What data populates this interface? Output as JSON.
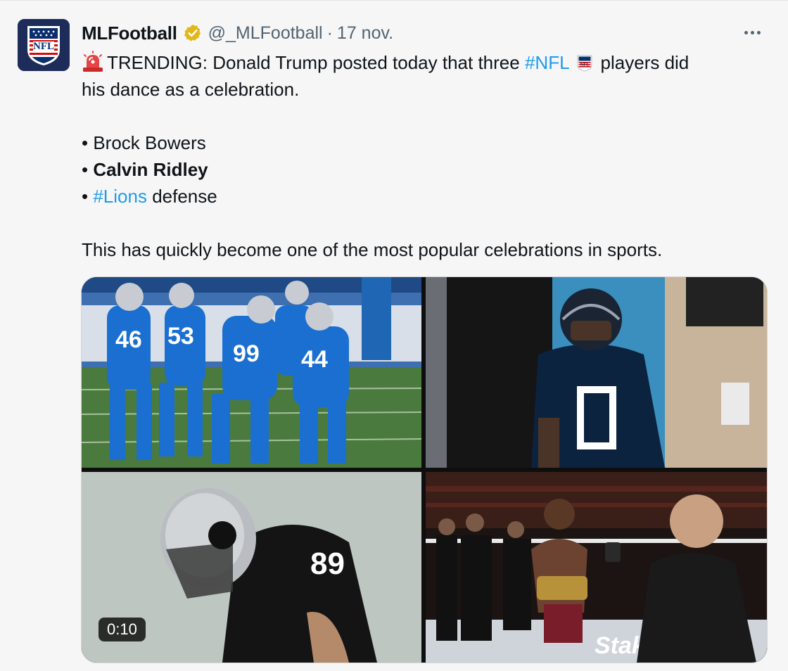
{
  "tweet": {
    "author": {
      "name": "MLFootball",
      "handle": "@_MLFootball",
      "verified": true,
      "avatar": "nfl-shield-logo",
      "avatar_text": "NFL"
    },
    "separator": "·",
    "date": "17 nov.",
    "more_icon": "more-horizontal-icon",
    "text": {
      "line1_prefix": "TRENDING: Donald Trump posted today that three",
      "line1_hashtag": "#NFL",
      "line1_suffix": "players did",
      "line2": "his dance as a celebration.",
      "bullets": [
        {
          "bullet": "•",
          "text": "Brock Bowers"
        },
        {
          "bullet": "•",
          "text": "Calvin Ridley",
          "bold": true
        },
        {
          "bullet": "•",
          "hashtag": "#Lions",
          "text": "defense"
        }
      ],
      "closing": "This has quickly become one of the most popular celebrations in sports."
    },
    "emoji_siren": "rotating-light-icon",
    "emoji_nfl": "nfl-shield-icon",
    "media": {
      "images": [
        {
          "id": "lions-players",
          "description_icon": "photo-lions"
        },
        {
          "id": "titans-player",
          "description_icon": "photo-titans"
        },
        {
          "id": "raiders-player",
          "description_icon": "photo-raiders"
        },
        {
          "id": "ufc-champion",
          "description_icon": "photo-ufc"
        }
      ],
      "video_duration": "0:10"
    },
    "colors": {
      "hashtag": "#1d9bf0",
      "text": "#0f1419",
      "secondary": "#536471",
      "verified_gold": "#e2b719",
      "background": "#f6f6f6"
    }
  }
}
